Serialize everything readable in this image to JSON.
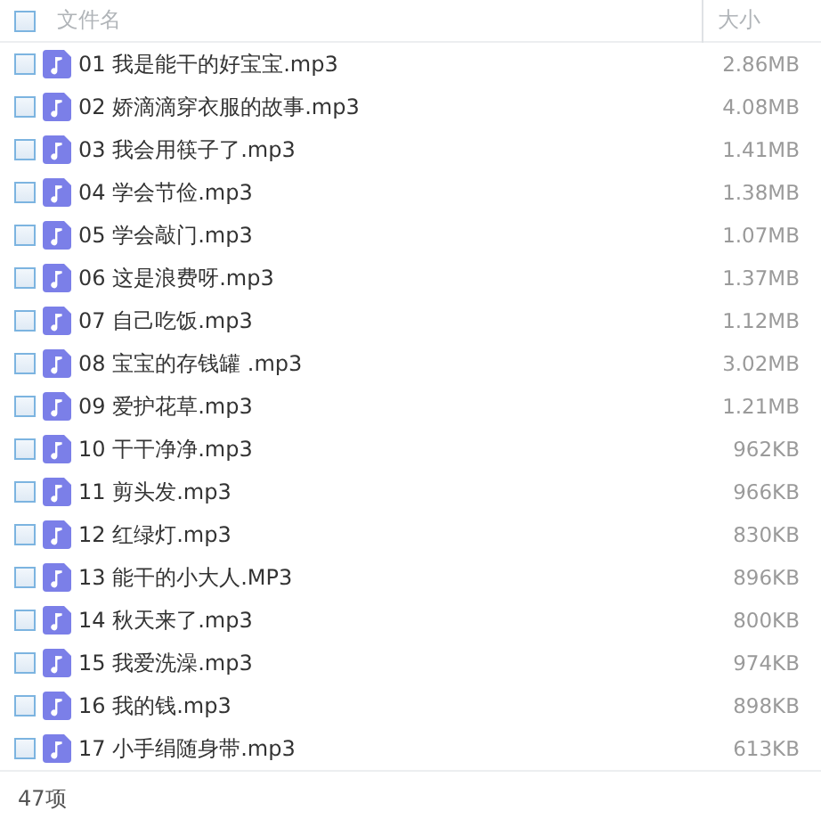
{
  "columns": {
    "name": "文件名",
    "size": "大小"
  },
  "header_checked": false,
  "files": [
    {
      "name": "01 我是能干的好宝宝.mp3",
      "size": "2.86MB",
      "checked": false
    },
    {
      "name": "02 娇滴滴穿衣服的故事.mp3",
      "size": "4.08MB",
      "checked": false
    },
    {
      "name": "03 我会用筷子了.mp3",
      "size": "1.41MB",
      "checked": false
    },
    {
      "name": "04 学会节俭.mp3",
      "size": "1.38MB",
      "checked": false
    },
    {
      "name": "05 学会敲门.mp3",
      "size": "1.07MB",
      "checked": false
    },
    {
      "name": "06 这是浪费呀.mp3",
      "size": "1.37MB",
      "checked": false
    },
    {
      "name": "07 自己吃饭.mp3",
      "size": "1.12MB",
      "checked": false
    },
    {
      "name": "08 宝宝的存钱罐 .mp3",
      "size": "3.02MB",
      "checked": false
    },
    {
      "name": "09 爱护花草.mp3",
      "size": "1.21MB",
      "checked": false
    },
    {
      "name": "10 干干净净.mp3",
      "size": "962KB",
      "checked": false
    },
    {
      "name": "11 剪头发.mp3",
      "size": "966KB",
      "checked": false
    },
    {
      "name": "12 红绿灯.mp3",
      "size": "830KB",
      "checked": false
    },
    {
      "name": "13 能干的小大人.MP3",
      "size": "896KB",
      "checked": false
    },
    {
      "name": "14 秋天来了.mp3",
      "size": "800KB",
      "checked": false
    },
    {
      "name": "15 我爱洗澡.mp3",
      "size": "974KB",
      "checked": false
    },
    {
      "name": "16 我的钱.mp3",
      "size": "898KB",
      "checked": false
    },
    {
      "name": "17 小手绢随身带.mp3",
      "size": "613KB",
      "checked": false
    }
  ],
  "status": "47项"
}
